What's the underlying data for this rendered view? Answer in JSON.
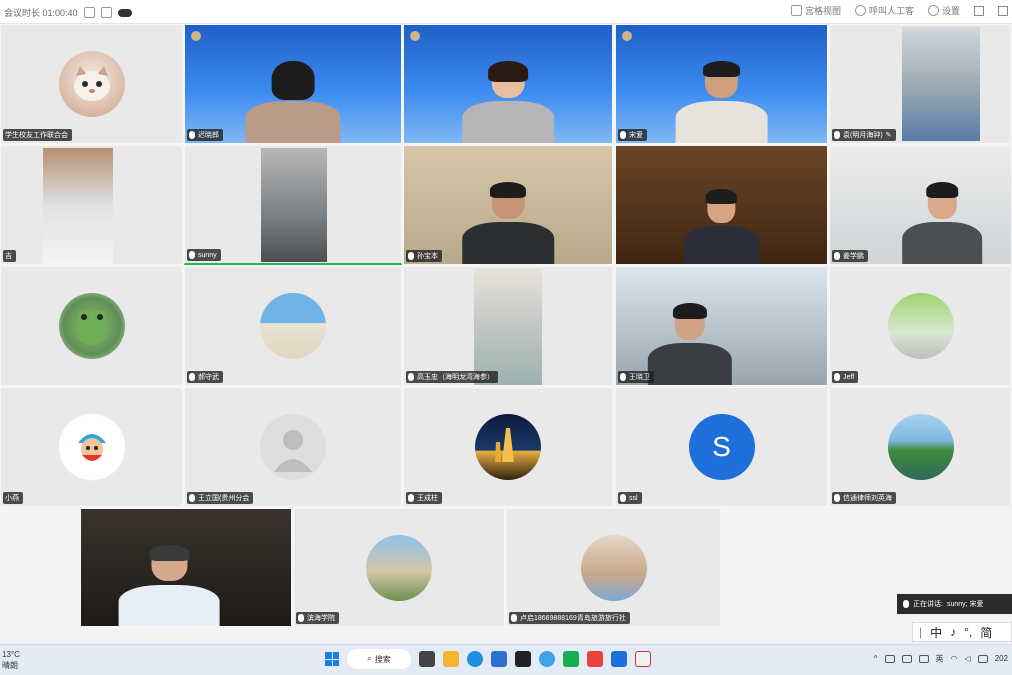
{
  "topbar": {
    "left_text": "会议时长 01:00:40",
    "items": [
      {
        "icon": "layout-icon",
        "label": "宫格视图"
      },
      {
        "icon": "assistant-icon",
        "label": "呼叫人工客"
      },
      {
        "icon": "settings-icon",
        "label": "设置"
      }
    ]
  },
  "participants": [
    {
      "name": "学生校友工作联合会",
      "kind": "avatar",
      "avatar": "cat"
    },
    {
      "name": "迟晓郎",
      "kind": "video",
      "scene": "blue"
    },
    {
      "name": "",
      "kind": "video",
      "scene": "blue"
    },
    {
      "name": "宋爱",
      "kind": "video",
      "scene": "blue"
    },
    {
      "name": "袁(明月海钟)",
      "kind": "video",
      "scene": "office"
    },
    {
      "name": "吉",
      "kind": "video",
      "scene": "room"
    },
    {
      "name": "sunny",
      "kind": "video",
      "scene": "room",
      "speaking": true
    },
    {
      "name": "孙宝本",
      "kind": "video",
      "scene": "map"
    },
    {
      "name": "",
      "kind": "video",
      "scene": "library"
    },
    {
      "name": "姜学鹏",
      "kind": "video",
      "scene": "room"
    },
    {
      "name": "",
      "kind": "avatar",
      "avatar": "frog"
    },
    {
      "name": "郝守武",
      "kind": "avatar",
      "avatar": "beach"
    },
    {
      "name": "高玉忠（海明龙湾海参）",
      "kind": "video",
      "scene": "room"
    },
    {
      "name": "王晓卫",
      "kind": "video",
      "scene": "car"
    },
    {
      "name": "Jeff",
      "kind": "avatar",
      "avatar": "people"
    },
    {
      "name": "小燕",
      "kind": "avatar",
      "avatar": "cartoon"
    },
    {
      "name": "王立国(贵州分会",
      "kind": "avatar",
      "avatar": "default"
    },
    {
      "name": "王成柱",
      "kind": "avatar",
      "avatar": "pagoda"
    },
    {
      "name": "ssl",
      "kind": "avatar",
      "avatar": "letter",
      "letter": "S"
    },
    {
      "name": "信通律师刘英海",
      "kind": "avatar",
      "avatar": "lake"
    },
    {
      "name": "",
      "kind": "video",
      "scene": "dark"
    },
    {
      "name": "滨海学院",
      "kind": "avatar",
      "avatar": "building"
    },
    {
      "name": "卢启18669888169青岛旅游旅行社",
      "kind": "avatar",
      "avatar": "woman"
    }
  ],
  "speaking_toast": {
    "label": "正在讲话:",
    "names": "sunny; 宋爱"
  },
  "ime": {
    "items": [
      "中",
      "♪",
      "°,",
      "简"
    ]
  },
  "taskbar": {
    "weather_temp": "13°C",
    "weather_desc": "晴朗",
    "search_label": "搜索",
    "tray_lang": "英",
    "clock": "202"
  },
  "colors": {
    "speaking_green": "#26b55c",
    "tencent_blue": "#1e6fd9"
  }
}
